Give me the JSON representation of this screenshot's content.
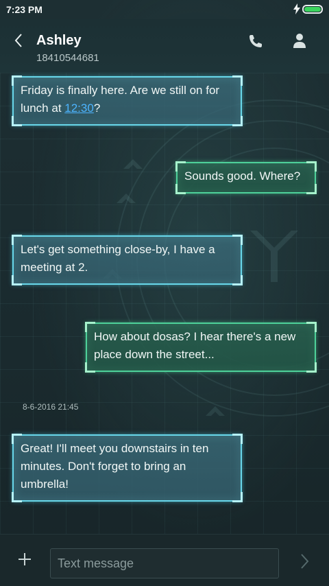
{
  "status_bar": {
    "time": "7:23 PM"
  },
  "header": {
    "contact_name": "Ashley",
    "phone_number": "18410544681"
  },
  "messages": [
    {
      "direction": "incoming",
      "text_before": "Friday is finally here. Are we still on for lunch at ",
      "link": "12:30",
      "text_after": "?"
    },
    {
      "direction": "outgoing",
      "text": "Sounds good. Where?"
    },
    {
      "direction": "incoming",
      "text": "Let's get something close-by, I have a meeting at 2."
    },
    {
      "direction": "outgoing",
      "text": "How about dosas? I hear there's a new place down the street..."
    },
    {
      "direction": "incoming",
      "text": "Great! I'll meet you downstairs in ten minutes. Don't forget to bring an umbrella!"
    }
  ],
  "timestamp": "8-6-2016 21:45",
  "compose": {
    "placeholder": "Text message"
  },
  "colors": {
    "incoming_border": "#68d7ea",
    "outgoing_border": "#4ed19a",
    "link": "#4db4ff",
    "battery": "#3bd45e"
  },
  "icons": [
    "back-arrow-icon",
    "phone-icon",
    "contact-icon",
    "plus-icon",
    "send-icon",
    "lightning-icon",
    "battery-icon"
  ]
}
